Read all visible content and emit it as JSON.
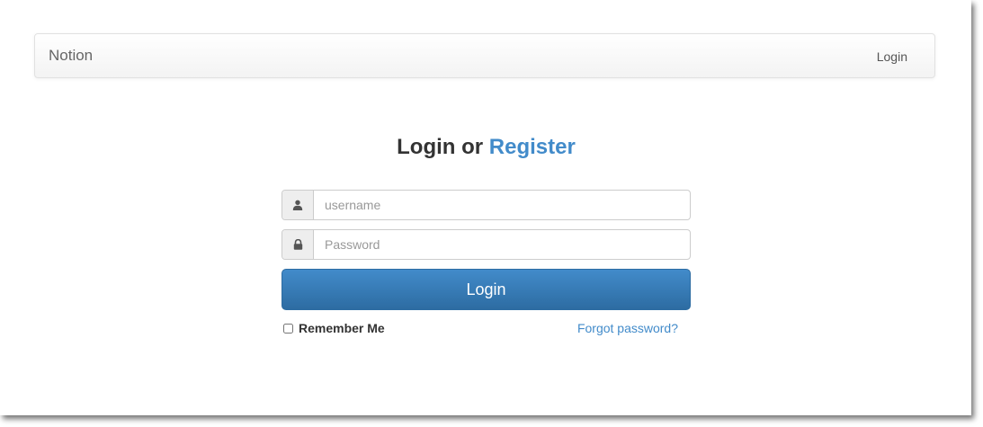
{
  "navbar": {
    "brand": "Notion",
    "login_link": "Login"
  },
  "form": {
    "heading_prefix": "Login or ",
    "heading_link": "Register",
    "username": {
      "placeholder": "username",
      "value": "",
      "icon": "user-icon"
    },
    "password": {
      "placeholder": "Password",
      "value": "",
      "icon": "lock-icon"
    },
    "submit_label": "Login",
    "remember_label": "Remember Me",
    "remember_checked": false,
    "forgot_label": "Forgot password?"
  },
  "colors": {
    "accent": "#428bca",
    "button_dark": "#2d6ca2"
  }
}
